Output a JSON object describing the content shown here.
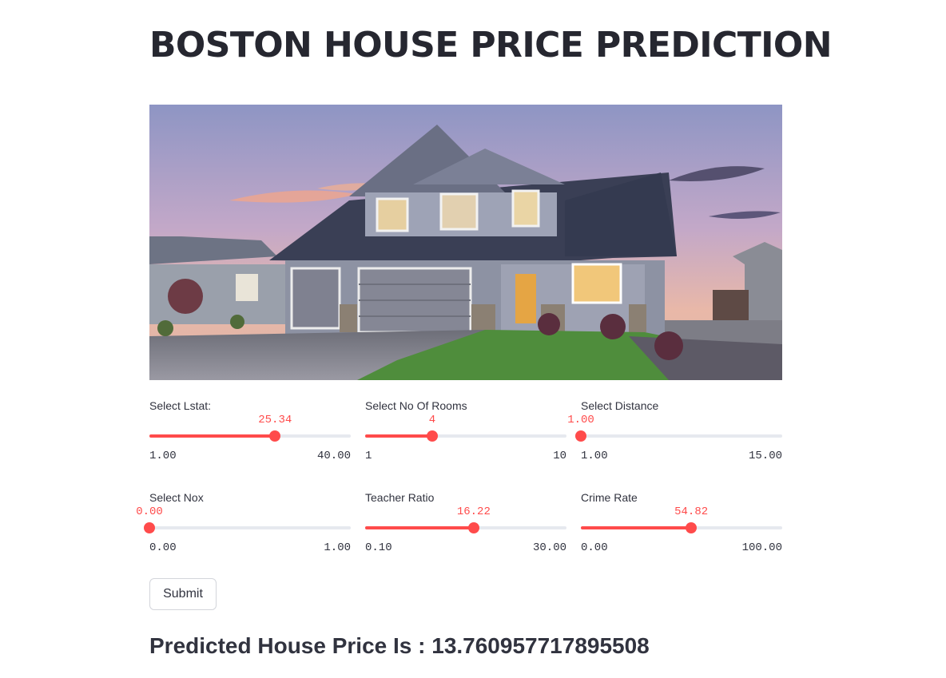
{
  "page": {
    "title": "BOSTON HOUSE PRICE PREDICTION"
  },
  "hero_image": {
    "subject": "two-story gray suburban house with garage at dusk"
  },
  "colors": {
    "accent": "#ff4b4b",
    "track": "#e6e9ef",
    "text": "#31333f"
  },
  "sliders": [
    {
      "label": "Select Lstat:",
      "value": "25.34",
      "min": "1.00",
      "max": "40.00",
      "fraction": 0.6241
    },
    {
      "label": "Select No Of Rooms",
      "value": "4",
      "min": "1",
      "max": "10",
      "fraction": 0.3333
    },
    {
      "label": "Select Distance",
      "value": "1.00",
      "min": "1.00",
      "max": "15.00",
      "fraction": 0
    },
    {
      "label": "Select Nox",
      "value": "0.00",
      "min": "0.00",
      "max": "1.00",
      "fraction": 0
    },
    {
      "label": "Teacher Ratio",
      "value": "16.22",
      "min": "0.10",
      "max": "30.00",
      "fraction": 0.5391
    },
    {
      "label": "Crime Rate",
      "value": "54.82",
      "min": "0.00",
      "max": "100.00",
      "fraction": 0.5482
    }
  ],
  "form": {
    "submit_label": "Submit"
  },
  "result": {
    "text": "Predicted House Price Is : 13.760957717895508"
  }
}
